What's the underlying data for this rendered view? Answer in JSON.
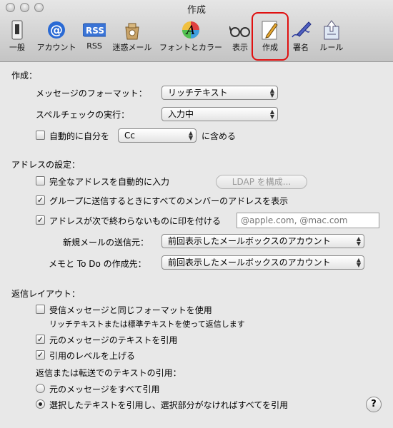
{
  "window": {
    "title": "作成"
  },
  "toolbar": {
    "items": [
      {
        "label": "一般",
        "icon": "switch-icon"
      },
      {
        "label": "アカウント",
        "icon": "at-icon"
      },
      {
        "label": "RSS",
        "icon": "rss-icon"
      },
      {
        "label": "迷惑メール",
        "icon": "junk-bag-icon"
      },
      {
        "label": "フォントとカラー",
        "icon": "font-color-icon"
      },
      {
        "label": "表示",
        "icon": "glasses-icon"
      },
      {
        "label": "作成",
        "icon": "compose-pencil-icon"
      },
      {
        "label": "署名",
        "icon": "signature-pen-icon"
      },
      {
        "label": "ルール",
        "icon": "rules-icon"
      }
    ],
    "selected": "作成",
    "highlight_color": "#e01010"
  },
  "compose": {
    "heading": "作成：",
    "format_label": "メッセージのフォーマット：",
    "format_value": "リッチテキスト",
    "spellcheck_label": "スペルチェックの実行：",
    "spellcheck_value": "入力中",
    "auto_self_label": "自動的に自分を",
    "auto_self_value": "Cc",
    "auto_self_suffix": "に含める",
    "auto_self_checked": false
  },
  "addressing": {
    "heading": "アドレスの設定：",
    "complete_addr_label": "完全なアドレスを自動的に入力",
    "complete_addr_checked": false,
    "ldap_button": "LDAP を構成...",
    "group_label": "グループに送信するときにすべてのメンバーのアドレスを表示",
    "group_checked": true,
    "mark_label": "アドレスが次で終わらないものに印を付ける",
    "mark_checked": true,
    "mark_placeholder": "@apple.com, @mac.com",
    "new_mail_from_label": "新規メールの送信元：",
    "new_mail_from_value": "前回表示したメールボックスのアカウント",
    "notes_todo_label": "メモと To Do の作成先：",
    "notes_todo_value": "前回表示したメールボックスのアカウント"
  },
  "reply": {
    "heading": "返信レイアウト：",
    "same_format_label": "受信メッセージと同じフォーマットを使用",
    "same_format_checked": false,
    "same_format_note": "リッチテキストまたは標準テキストを使って返信します",
    "quote_text_label": "元のメッセージのテキストを引用",
    "quote_text_checked": true,
    "increase_level_label": "引用のレベルを上げる",
    "increase_level_checked": true,
    "quoting_heading": "返信または転送でのテキストの引用：",
    "radio_all_label": "元のメッセージをすべて引用",
    "radio_selected_label": "選択したテキストを引用し、選択部分がなければすべてを引用",
    "selected_radio": "selected"
  },
  "help": {
    "label": "?"
  }
}
